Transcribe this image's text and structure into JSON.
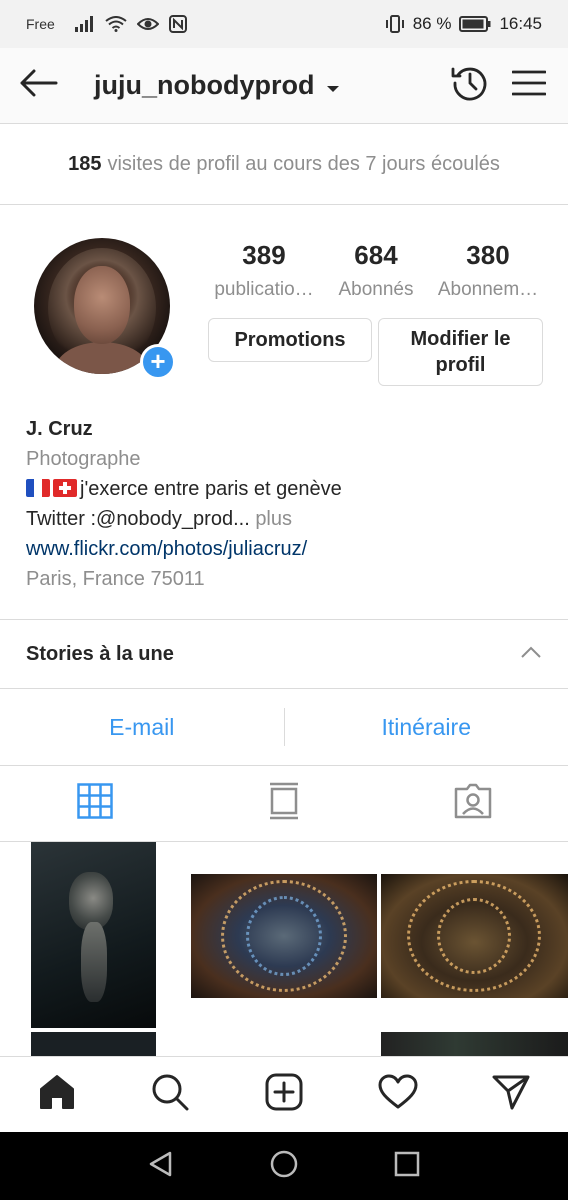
{
  "status_bar": {
    "carrier": "Free",
    "battery": "86 %",
    "time": "16:45"
  },
  "header": {
    "username": "juju_nobodyprod",
    "back_icon": "arrow-left-icon",
    "archive_icon": "history-icon",
    "menu_icon": "menu-icon"
  },
  "visits": {
    "count": "185",
    "text": "visites de profil au cours des 7 jours écoulés"
  },
  "profile": {
    "stats": [
      {
        "value": "389",
        "label": "publicatio…"
      },
      {
        "value": "684",
        "label": "Abonnés"
      },
      {
        "value": "380",
        "label": "Abonnem…"
      }
    ],
    "promotions_label": "Promotions",
    "edit_label": "Modifier le profil"
  },
  "bio": {
    "name": "J. Cruz",
    "category": "Photographe",
    "line": "j'exerce entre paris et genève",
    "twitter": "Twitter :@nobody_prod...",
    "more": "plus",
    "link": "www.flickr.com/photos/juliacruz/",
    "location": "Paris, France 75011"
  },
  "stories": {
    "title": "Stories à la une"
  },
  "contact": {
    "email_label": "E-mail",
    "directions_label": "Itinéraire"
  },
  "tabs": [
    "grid-icon",
    "feed-icon",
    "tagged-icon"
  ],
  "bottom_nav": [
    "home-icon",
    "search-icon",
    "add-icon",
    "heart-icon",
    "direct-icon"
  ],
  "colors": {
    "accent": "#3897f0",
    "link": "#003569",
    "muted": "#8e8e8e",
    "text": "#262626"
  }
}
